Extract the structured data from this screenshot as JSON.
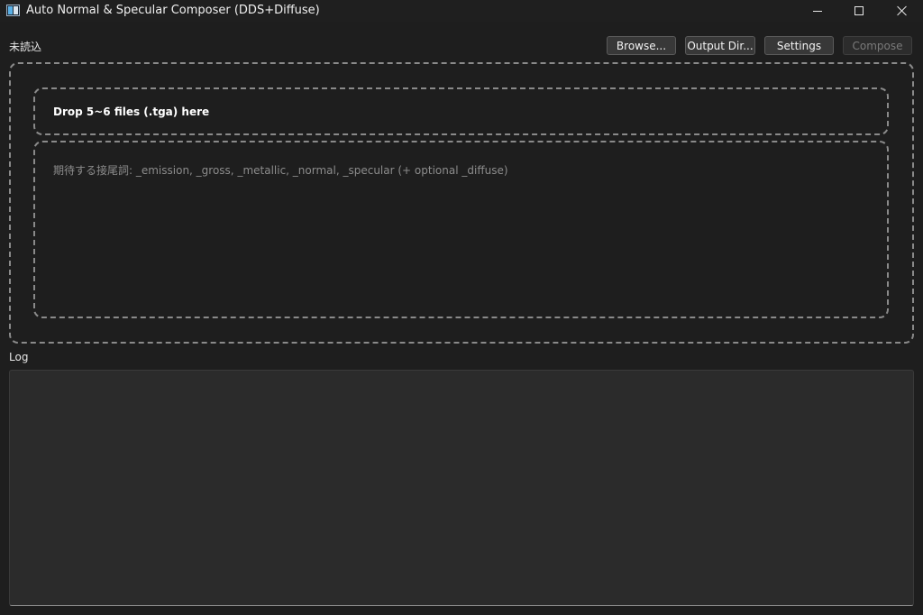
{
  "window": {
    "title": "Auto Normal & Specular Composer (DDS+Diffuse)",
    "controls": [
      "minimize",
      "maximize",
      "close"
    ]
  },
  "status": {
    "text": "未読込"
  },
  "toolbar": {
    "browse_label": "Browse...",
    "output_dir_label": "Output Dir...",
    "settings_label": "Settings",
    "compose_label": "Compose",
    "compose_enabled": false
  },
  "drop_zone": {
    "text": "Drop 5~6 files (.tga) here"
  },
  "expected": {
    "text": "期待する接尾詞: _emission, _gross, _metallic, _normal, _specular (+ optional _diffuse)"
  },
  "log": {
    "label": "Log",
    "content": ""
  },
  "icons": {
    "app": "app-icon",
    "minimize": "minimize-icon",
    "maximize": "maximize-icon",
    "close": "close-icon"
  },
  "colors": {
    "background": "#1e1e1e",
    "button": "#383838",
    "dashed_border": "#8a8a8a",
    "log_background": "#2b2b2b"
  }
}
